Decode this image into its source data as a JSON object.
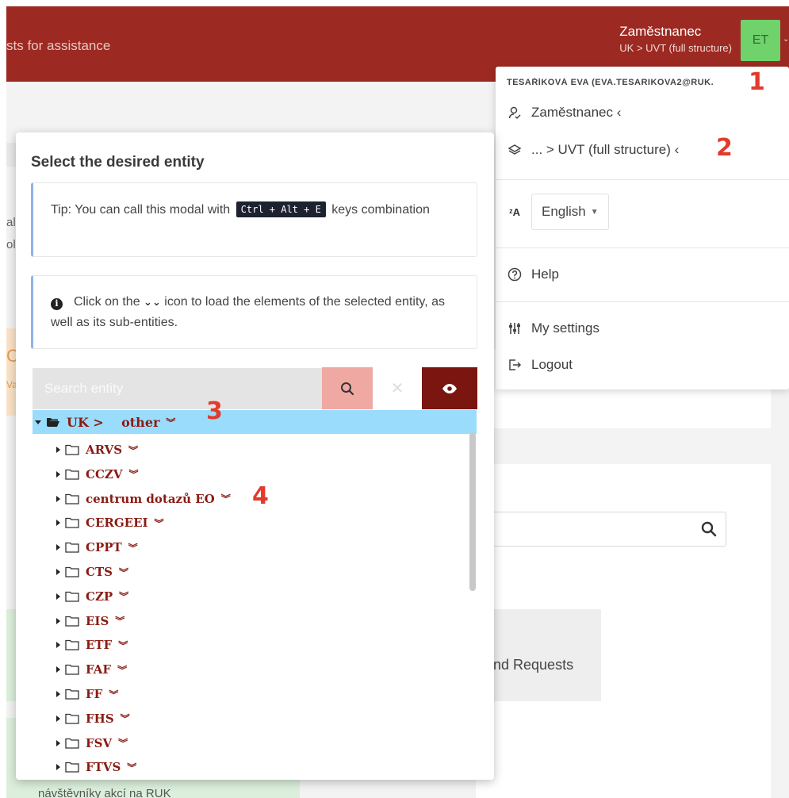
{
  "header": {
    "assist_text": "sts for assistance",
    "user_role": "Zaměstnanec",
    "user_path": "UK > UVT (full structure)",
    "avatar_initials": "ET"
  },
  "user_menu": {
    "user_line": "TESAŘÍKOVÁ EVA (EVA.TESARIKOVA2@RUK.",
    "role_label": "Zaměstnanec ‹",
    "structure_label": "... > UVT (full structure) ‹",
    "language": "English",
    "help_label": "Help",
    "settings_label": "My settings",
    "logout_label": "Logout"
  },
  "callouts": [
    "1",
    "2",
    "3",
    "4"
  ],
  "modal": {
    "title": "Select the desired entity",
    "tip_prefix": "Tip: You can call this modal with",
    "tip_keys": "Ctrl + Alt + E",
    "tip_suffix": "keys combination",
    "info_prefix": "Click on the",
    "info_suffix": "icon to load the elements of the selected entity, as well as its sub-entities.",
    "search_placeholder": "Search entity",
    "tree_root": "UK >    other",
    "tree_items": [
      "ARVS",
      "CCZV",
      "centrum dotazů EO",
      "CERGEEI",
      "CPPT",
      "CTS",
      "CZP",
      "EIS",
      "ETF",
      "FAF",
      "FF",
      "FHS",
      "FSV",
      "FTVS"
    ]
  },
  "background": {
    "tile_text": "nd Requests",
    "bottom_text": "návštěvníky akcí na RUK",
    "cut_text_1": "al",
    "cut_text_2": "ol",
    "cut_text_3": "C",
    "cut_text_4": "Va"
  },
  "colors": {
    "header": "#9c2a22",
    "avatar": "#6fd26b",
    "tree_selected": "#9adcfb",
    "tree_text": "#8a1b14",
    "eye_button": "#7a1510",
    "search_button": "#f0a8a2",
    "callout": "#e23a2c"
  },
  "icons": [
    "user-icon",
    "layers-icon",
    "translate-icon",
    "help-icon",
    "sliders-icon",
    "logout-icon",
    "search-icon",
    "close-icon",
    "eye-icon",
    "info-icon",
    "double-chevron-icon",
    "folder-icon",
    "folder-open-icon",
    "caret-right-icon",
    "caret-down-icon"
  ]
}
